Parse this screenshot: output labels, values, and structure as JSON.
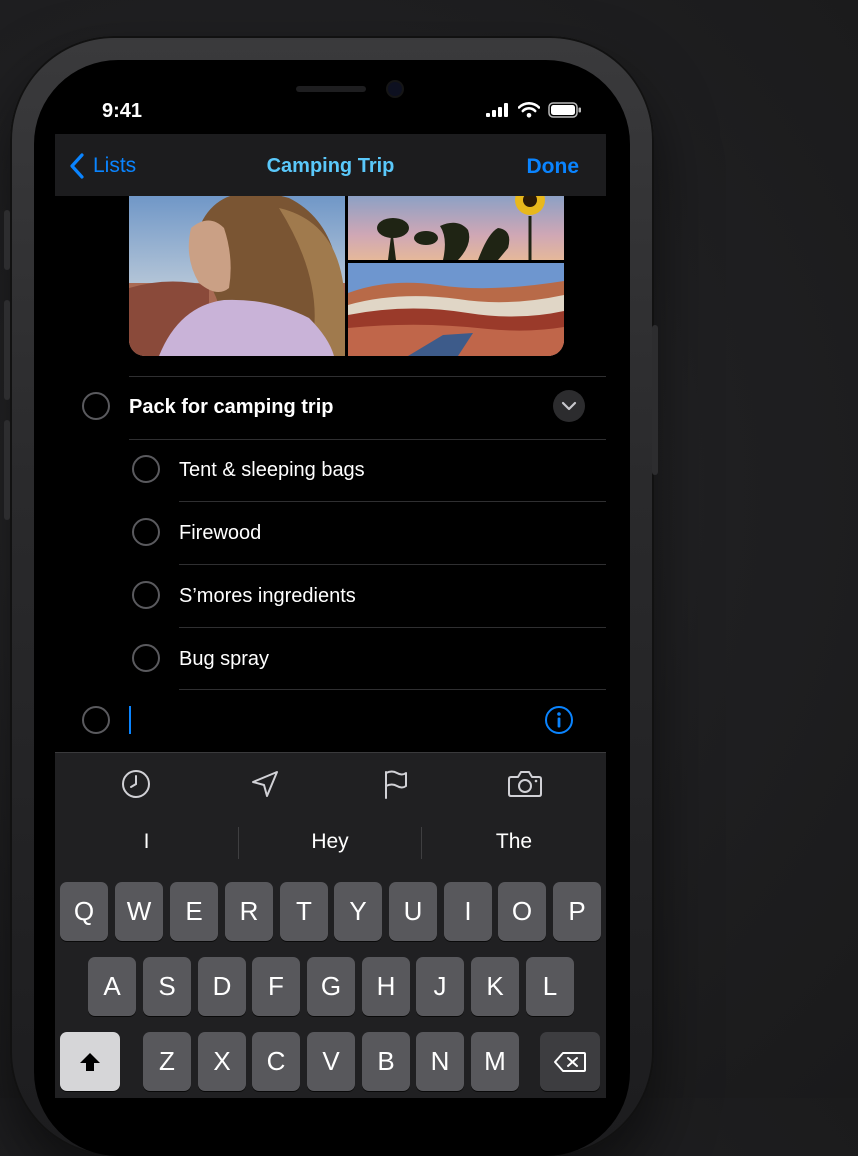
{
  "status": {
    "time": "9:41"
  },
  "nav": {
    "back_label": "Lists",
    "title": "Camping Trip",
    "done_label": "Done"
  },
  "reminders": {
    "parent": "Pack for camping trip",
    "subtasks": [
      "Tent & sleeping bags",
      "Firewood",
      "S’mores ingredients",
      "Bug spray"
    ],
    "new_item": ""
  },
  "toolbar": {
    "icons": [
      "clock-icon",
      "location-arrow-icon",
      "flag-icon",
      "camera-icon"
    ]
  },
  "suggestions": [
    "I",
    "Hey",
    "The"
  ],
  "keyboard": {
    "row1": [
      "Q",
      "W",
      "E",
      "R",
      "T",
      "Y",
      "U",
      "I",
      "O",
      "P"
    ],
    "row2": [
      "A",
      "S",
      "D",
      "F",
      "G",
      "H",
      "J",
      "K",
      "L"
    ],
    "row3": [
      "Z",
      "X",
      "C",
      "V",
      "B",
      "N",
      "M"
    ]
  },
  "colors": {
    "accent": "#0a84ff",
    "title": "#5ac8fa",
    "background": "#000000",
    "keyboard": "#202022"
  }
}
